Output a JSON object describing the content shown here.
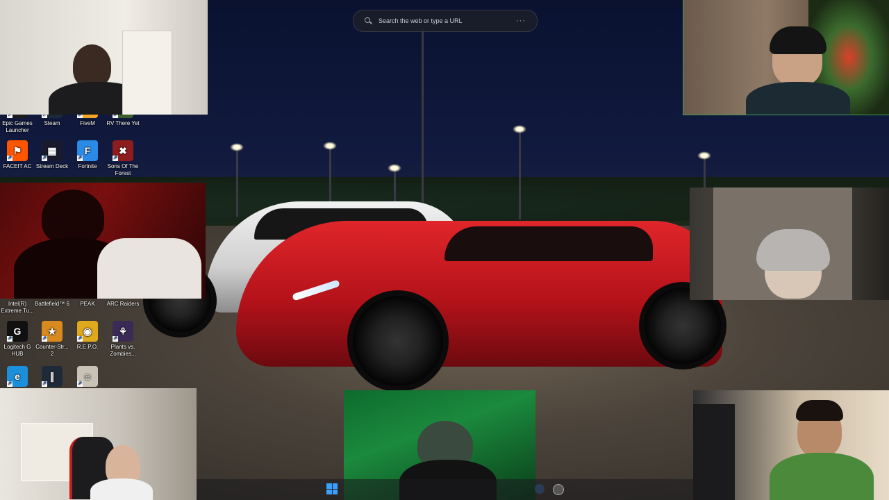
{
  "browser_search": {
    "placeholder": "Search the web or type a URL",
    "menu_glyph": "···"
  },
  "desktop_icons": [
    {
      "label": "Epic Games Launcher",
      "glyph": "",
      "color": "#1b1b1b"
    },
    {
      "label": "Steam",
      "glyph": "",
      "color": "#1b2838"
    },
    {
      "label": "FiveM",
      "glyph": "",
      "color": "#f5a524"
    },
    {
      "label": "RV There Yet",
      "glyph": "",
      "color": "#3c5e2a"
    },
    {
      "label": "FACEIT AC",
      "glyph": "⚑",
      "color": "#ff5500"
    },
    {
      "label": "Stream Deck",
      "glyph": "▦",
      "color": "#1a1a2e"
    },
    {
      "label": "Fortnite",
      "glyph": "F",
      "color": "#2b8ae6"
    },
    {
      "label": "Sons Of The Forest",
      "glyph": "✖",
      "color": "#8e1d1d"
    },
    {
      "label": "Intel(R) Extreme Tu...",
      "glyph": "",
      "color": "#0068b5"
    },
    {
      "label": "Battlefield™ 6",
      "glyph": "",
      "color": "#3a3a3a"
    },
    {
      "label": "PEAK",
      "glyph": "",
      "color": "#6b8e4e"
    },
    {
      "label": "ARC Raiders",
      "glyph": "",
      "color": "#2b2b2b"
    },
    {
      "label": "Logitech G HUB",
      "glyph": "G",
      "color": "#101010"
    },
    {
      "label": "Counter-Str... 2",
      "glyph": "★",
      "color": "#d98a1f"
    },
    {
      "label": "R.E.P.O.",
      "glyph": "◉",
      "color": "#e0a81c"
    },
    {
      "label": "Plants vs. Zombies...",
      "glyph": "⚘",
      "color": "#3b2a56"
    },
    {
      "label": "",
      "glyph": "e",
      "color": "#1b8fd9"
    },
    {
      "label": "",
      "glyph": "∥",
      "color": "#1f2a38"
    },
    {
      "label": "",
      "glyph": "☺",
      "color": "#c9c2b6"
    }
  ],
  "colors": {
    "active_cam_border": "#3aa14a",
    "start_blue": "#3aa0ff"
  }
}
